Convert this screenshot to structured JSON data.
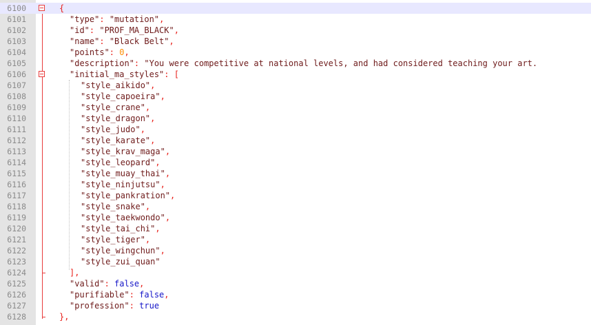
{
  "editor": {
    "lines": [
      {
        "num": "6100",
        "indent": 1,
        "tokens": [
          {
            "t": "{",
            "c": "op"
          }
        ],
        "current": true,
        "fold": "start"
      },
      {
        "num": "6101",
        "indent": 2,
        "tokens": [
          {
            "t": "\"type\"",
            "c": "str"
          },
          {
            "t": ": ",
            "c": "op"
          },
          {
            "t": "\"mutation\"",
            "c": "str"
          },
          {
            "t": ",",
            "c": "op"
          }
        ]
      },
      {
        "num": "6102",
        "indent": 2,
        "tokens": [
          {
            "t": "\"id\"",
            "c": "str"
          },
          {
            "t": ": ",
            "c": "op"
          },
          {
            "t": "\"PROF_MA_BLACK\"",
            "c": "str"
          },
          {
            "t": ",",
            "c": "op"
          }
        ]
      },
      {
        "num": "6103",
        "indent": 2,
        "tokens": [
          {
            "t": "\"name\"",
            "c": "str"
          },
          {
            "t": ": ",
            "c": "op"
          },
          {
            "t": "\"Black Belt\"",
            "c": "str"
          },
          {
            "t": ",",
            "c": "op"
          }
        ]
      },
      {
        "num": "6104",
        "indent": 2,
        "tokens": [
          {
            "t": "\"points\"",
            "c": "str"
          },
          {
            "t": ": ",
            "c": "op"
          },
          {
            "t": "0",
            "c": "num"
          },
          {
            "t": ",",
            "c": "op"
          }
        ]
      },
      {
        "num": "6105",
        "indent": 2,
        "tokens": [
          {
            "t": "\"description\"",
            "c": "str"
          },
          {
            "t": ": ",
            "c": "op"
          },
          {
            "t": "\"You were competitive at national levels, and had considered teaching your art.",
            "c": "str"
          }
        ]
      },
      {
        "num": "6106",
        "indent": 2,
        "tokens": [
          {
            "t": "\"initial_ma_styles\"",
            "c": "str"
          },
          {
            "t": ": ",
            "c": "op"
          },
          {
            "t": "[",
            "c": "op"
          }
        ],
        "fold": "start"
      },
      {
        "num": "6107",
        "indent": 3,
        "tokens": [
          {
            "t": "\"style_aikido\"",
            "c": "str"
          },
          {
            "t": ",",
            "c": "op"
          }
        ]
      },
      {
        "num": "6108",
        "indent": 3,
        "tokens": [
          {
            "t": "\"style_capoeira\"",
            "c": "str"
          },
          {
            "t": ",",
            "c": "op"
          }
        ]
      },
      {
        "num": "6109",
        "indent": 3,
        "tokens": [
          {
            "t": "\"style_crane\"",
            "c": "str"
          },
          {
            "t": ",",
            "c": "op"
          }
        ]
      },
      {
        "num": "6110",
        "indent": 3,
        "tokens": [
          {
            "t": "\"style_dragon\"",
            "c": "str"
          },
          {
            "t": ",",
            "c": "op"
          }
        ]
      },
      {
        "num": "6111",
        "indent": 3,
        "tokens": [
          {
            "t": "\"style_judo\"",
            "c": "str"
          },
          {
            "t": ",",
            "c": "op"
          }
        ]
      },
      {
        "num": "6112",
        "indent": 3,
        "tokens": [
          {
            "t": "\"style_karate\"",
            "c": "str"
          },
          {
            "t": ",",
            "c": "op"
          }
        ]
      },
      {
        "num": "6113",
        "indent": 3,
        "tokens": [
          {
            "t": "\"style_krav_maga\"",
            "c": "str"
          },
          {
            "t": ",",
            "c": "op"
          }
        ]
      },
      {
        "num": "6114",
        "indent": 3,
        "tokens": [
          {
            "t": "\"style_leopard\"",
            "c": "str"
          },
          {
            "t": ",",
            "c": "op"
          }
        ]
      },
      {
        "num": "6115",
        "indent": 3,
        "tokens": [
          {
            "t": "\"style_muay_thai\"",
            "c": "str"
          },
          {
            "t": ",",
            "c": "op"
          }
        ]
      },
      {
        "num": "6116",
        "indent": 3,
        "tokens": [
          {
            "t": "\"style_ninjutsu\"",
            "c": "str"
          },
          {
            "t": ",",
            "c": "op"
          }
        ]
      },
      {
        "num": "6117",
        "indent": 3,
        "tokens": [
          {
            "t": "\"style_pankration\"",
            "c": "str"
          },
          {
            "t": ",",
            "c": "op"
          }
        ]
      },
      {
        "num": "6118",
        "indent": 3,
        "tokens": [
          {
            "t": "\"style_snake\"",
            "c": "str"
          },
          {
            "t": ",",
            "c": "op"
          }
        ]
      },
      {
        "num": "6119",
        "indent": 3,
        "tokens": [
          {
            "t": "\"style_taekwondo\"",
            "c": "str"
          },
          {
            "t": ",",
            "c": "op"
          }
        ]
      },
      {
        "num": "6120",
        "indent": 3,
        "tokens": [
          {
            "t": "\"style_tai_chi\"",
            "c": "str"
          },
          {
            "t": ",",
            "c": "op"
          }
        ]
      },
      {
        "num": "6121",
        "indent": 3,
        "tokens": [
          {
            "t": "\"style_tiger\"",
            "c": "str"
          },
          {
            "t": ",",
            "c": "op"
          }
        ]
      },
      {
        "num": "6122",
        "indent": 3,
        "tokens": [
          {
            "t": "\"style_wingchun\"",
            "c": "str"
          },
          {
            "t": ",",
            "c": "op"
          }
        ]
      },
      {
        "num": "6123",
        "indent": 3,
        "tokens": [
          {
            "t": "\"style_zui_quan\"",
            "c": "str"
          }
        ]
      },
      {
        "num": "6124",
        "indent": 2,
        "tokens": [
          {
            "t": "],",
            "c": "op"
          }
        ],
        "fold": "end"
      },
      {
        "num": "6125",
        "indent": 2,
        "tokens": [
          {
            "t": "\"valid\"",
            "c": "str"
          },
          {
            "t": ": ",
            "c": "op"
          },
          {
            "t": "false",
            "c": "kw"
          },
          {
            "t": ",",
            "c": "op"
          }
        ]
      },
      {
        "num": "6126",
        "indent": 2,
        "tokens": [
          {
            "t": "\"purifiable\"",
            "c": "str"
          },
          {
            "t": ": ",
            "c": "op"
          },
          {
            "t": "false",
            "c": "kw"
          },
          {
            "t": ",",
            "c": "op"
          }
        ]
      },
      {
        "num": "6127",
        "indent": 2,
        "tokens": [
          {
            "t": "\"profession\"",
            "c": "str"
          },
          {
            "t": ": ",
            "c": "op"
          },
          {
            "t": "true",
            "c": "kw"
          }
        ]
      },
      {
        "num": "6128",
        "indent": 1,
        "tokens": [
          {
            "t": "},",
            "c": "op"
          }
        ],
        "fold": "end"
      }
    ]
  }
}
